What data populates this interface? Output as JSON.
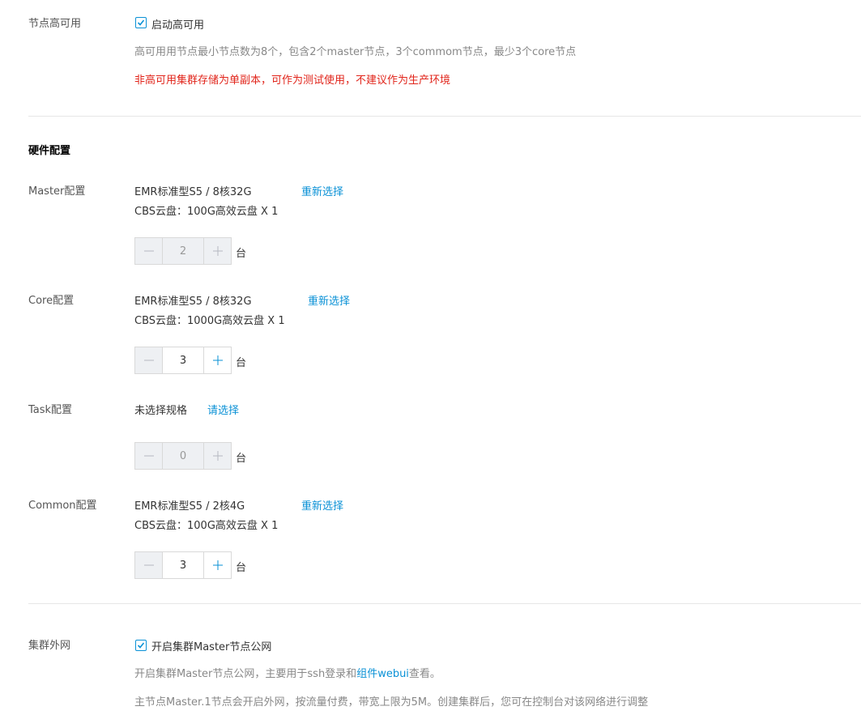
{
  "ha": {
    "label": "节点高可用",
    "checkbox_label": "启动高可用",
    "checked": true,
    "hint": "高可用用节点最小节点数为8个，包含2个master节点，3个commom节点，最少3个core节点",
    "warning": "非高可用集群存储为单副本，可作为测试使用，不建议作为生产环境"
  },
  "hardware": {
    "title": "硬件配置",
    "unit": "台",
    "master": {
      "label": "Master配置",
      "spec": "EMR标准型S5 / 8核32G",
      "disk": "CBS云盘：100G高效云盘 X 1",
      "action": "重新选择",
      "count": "2",
      "disabled": true
    },
    "core": {
      "label": "Core配置",
      "spec": "EMR标准型S5 / 8核32G",
      "disk": "CBS云盘：1000G高效云盘 X 1",
      "action": "重新选择",
      "count": "3",
      "disabled": false
    },
    "task": {
      "label": "Task配置",
      "spec": "未选择规格",
      "action": "请选择",
      "count": "0",
      "disabled": true
    },
    "common": {
      "label": "Common配置",
      "spec": "EMR标准型S5 / 2核4G",
      "disk": "CBS云盘：100G高效云盘 X 1",
      "action": "重新选择",
      "count": "3",
      "disabled": false
    }
  },
  "network": {
    "label": "集群外网",
    "checkbox_label": "开启集群Master节点公网",
    "checked": true,
    "hint_prefix": "开启集群Master节点公网，主要用于ssh登录和",
    "hint_link": "组件webui",
    "hint_suffix": "查看。",
    "note": "主节点Master.1节点会开启外网，按流量付费，带宽上限为5M。创建集群后，您可在控制台对该网络进行调整"
  },
  "colors": {
    "accent": "#0a91d6",
    "warning": "#e1251b",
    "divider": "#e6e6e6",
    "disabled_bg": "#eef0f3"
  },
  "icons": {
    "check": "check-icon",
    "minus": "minus-icon",
    "plus": "plus-icon"
  }
}
